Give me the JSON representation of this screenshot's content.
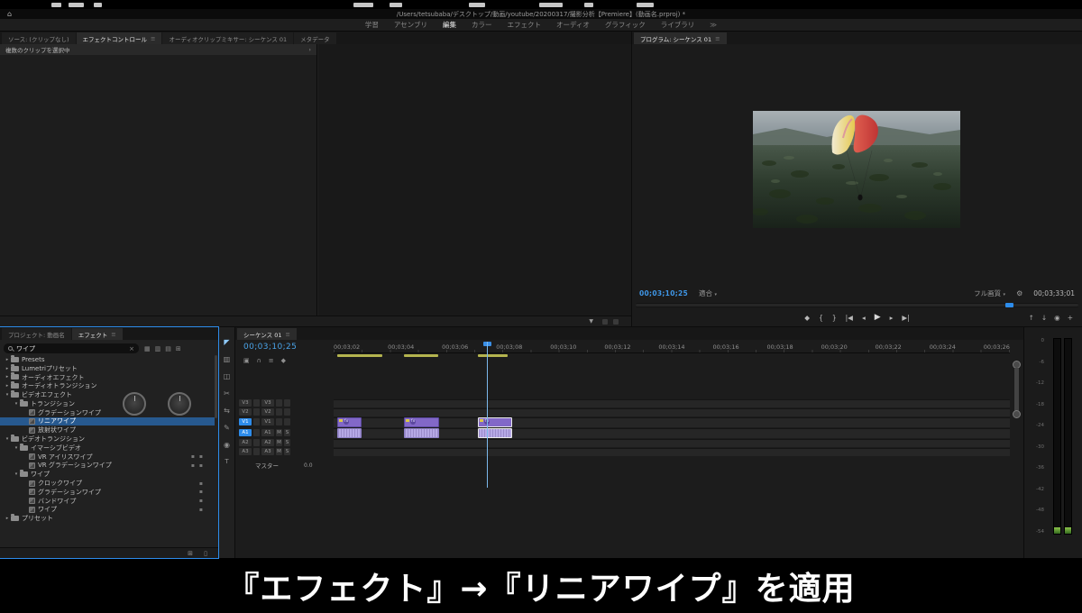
{
  "titlebar": {
    "home_icon": "⌂",
    "title": "/Users/tetsubaba/デスクトップ/動画/youtube/20200317/撮影分析【Premiere】(動画名.prproj) *"
  },
  "workspace": {
    "tabs": [
      "学習",
      "アセンブリ",
      "編集",
      "カラー",
      "エフェクト",
      "オーディオ",
      "グラフィック",
      "ライブラリ"
    ],
    "active_tab": "編集",
    "overflow_icon": "≫"
  },
  "effect_controls": {
    "tab_source": "ソース: (クリップなし)",
    "tab_effect_controls": "エフェクトコントロール",
    "tab_mixer": "オーディオクリップミキサー: シーケンス 01",
    "tab_metadata": "メタデータ",
    "panel_menu_icon": "≡",
    "status_text": "複数のクリップを選択中",
    "chevron_icon": "›",
    "filter_icon": "▼"
  },
  "program": {
    "tab_label": "プログラム: シーケンス 01",
    "panel_menu_icon": "≡",
    "current_timecode": "00;03;10;25",
    "zoom_level": "適合",
    "zoom_caret": "▾",
    "quality": "フル画質",
    "quality_caret": "▾",
    "settings_icon": "⚙",
    "duration_timecode": "00;03;33;01",
    "transport": [
      {
        "name": "add-marker",
        "glyph": "◆"
      },
      {
        "name": "mark-in",
        "glyph": "{"
      },
      {
        "name": "mark-out",
        "glyph": "}"
      },
      {
        "name": "go-to-in",
        "glyph": "|◀"
      },
      {
        "name": "step-back",
        "glyph": "◂"
      },
      {
        "name": "play",
        "glyph": "▶"
      },
      {
        "name": "step-forward",
        "glyph": "▸"
      },
      {
        "name": "go-to-out",
        "glyph": "▶|"
      },
      {
        "name": "lift",
        "glyph": "↑"
      },
      {
        "name": "extract",
        "glyph": "↓"
      },
      {
        "name": "export-frame",
        "glyph": "◉"
      },
      {
        "name": "button-editor",
        "glyph": "+"
      }
    ]
  },
  "tools": [
    {
      "name": "selection-tool",
      "glyph": "◤"
    },
    {
      "name": "track-select-tool",
      "glyph": "▥"
    },
    {
      "name": "ripple-edit-tool",
      "glyph": "◫"
    },
    {
      "name": "razor-tool",
      "glyph": "✂"
    },
    {
      "name": "slip-tool",
      "glyph": "⇆"
    },
    {
      "name": "pen-tool",
      "glyph": "✎"
    },
    {
      "name": "hand-tool",
      "glyph": "◉"
    },
    {
      "name": "type-tool",
      "glyph": "T"
    }
  ],
  "effects_panel": {
    "tab_project": "プロジェクト: 動画名",
    "tab_effects": "エフェクト",
    "panel_menu_icon": "≡",
    "search_value": "ワイプ",
    "search_clear_icon": "×",
    "toolbar_icons": [
      {
        "name": "filter-accelerated-icon",
        "glyph": "▦"
      },
      {
        "name": "filter-32bit-icon",
        "glyph": "▥"
      },
      {
        "name": "filter-yuv-icon",
        "glyph": "▤"
      },
      {
        "name": "new-custom-bin-icon",
        "glyph": "⊞"
      }
    ],
    "tree": [
      {
        "arrow": "▸",
        "label": "Presets",
        "badges": ""
      },
      {
        "arrow": "▸",
        "label": "Lumetriプリセット",
        "badges": ""
      },
      {
        "arrow": "▸",
        "label": "オーディオエフェクト",
        "badges": ""
      },
      {
        "arrow": "▸",
        "label": "オーディオトランジション",
        "badges": ""
      },
      {
        "arrow": "▾",
        "label": "ビデオエフェクト",
        "badges": ""
      },
      {
        "arrow": "▾",
        "label": "トランジション",
        "badges": ""
      },
      {
        "arrow": "",
        "label": "グラデーションワイプ",
        "badges": ""
      },
      {
        "arrow": "",
        "label": "リニアワイプ",
        "badges": ""
      },
      {
        "arrow": "",
        "label": "放射状ワイプ",
        "badges": ""
      },
      {
        "arrow": "▾",
        "label": "ビデオトランジション",
        "badges": ""
      },
      {
        "arrow": "▾",
        "label": "イマーシブビデオ",
        "badges": ""
      },
      {
        "arrow": "",
        "label": "VR アイリスワイプ",
        "badges": "▪▪"
      },
      {
        "arrow": "",
        "label": "VR グラデーションワイプ",
        "badges": "▪▪"
      },
      {
        "arrow": "▾",
        "label": "ワイプ",
        "badges": ""
      },
      {
        "arrow": "",
        "label": "クロックワイプ",
        "badges": "▪"
      },
      {
        "arrow": "",
        "label": "グラデーションワイプ",
        "badges": "▪"
      },
      {
        "arrow": "",
        "label": "バンドワイプ",
        "badges": "▪"
      },
      {
        "arrow": "",
        "label": "ワイプ",
        "badges": "▪"
      },
      {
        "arrow": "▸",
        "label": "プリセット",
        "badges": ""
      }
    ]
  },
  "timeline": {
    "tab_label": "シーケンス 01",
    "panel_menu_icon": "≡",
    "timecode": "00;03;10;25",
    "toolbar": [
      {
        "name": "nest-sequence-icon",
        "glyph": "▣"
      },
      {
        "name": "snap-icon",
        "glyph": "∩"
      },
      {
        "name": "linked-selection-icon",
        "glyph": "≡"
      },
      {
        "name": "add-marker-icon",
        "glyph": "◆"
      }
    ],
    "ruler_labels": [
      "00;03;02",
      "00;03;04",
      "00;03;06",
      "00;03;08",
      "00;03;10",
      "00;03;12",
      "00;03;14",
      "00;03;16",
      "00;03;18",
      "00;03;20",
      "00;03;22",
      "00;03;24",
      "00;03;26"
    ],
    "tracks": [
      {
        "name": "V3"
      },
      {
        "name": "V2"
      },
      {
        "name": "V1"
      },
      {
        "name": "A1"
      },
      {
        "name": "A2"
      },
      {
        "name": "A3"
      }
    ],
    "audio_mute_label": "M",
    "audio_solo_label": "S",
    "master_label": "マスター",
    "master_value": "0.0",
    "clips": [
      {
        "fx": "fx"
      },
      {
        "fx": "fx"
      },
      {
        "fx": "fx"
      }
    ]
  },
  "meters": {
    "scale": [
      "0",
      "-6",
      "-12",
      "-18",
      "-24",
      "-30",
      "-36",
      "-42",
      "-48",
      "-54"
    ]
  },
  "caption": {
    "text": "『エフェクト』→『リニアワイプ』を適用"
  },
  "colors": {
    "accent_blue": "#2d8ceb",
    "timecode_blue": "#3f97e8",
    "clip_video_purple": "#8268c8",
    "clip_audio_lavender": "#b6a9e6",
    "selection_blue": "#27598f",
    "marker_olive": "#b4b44e"
  }
}
